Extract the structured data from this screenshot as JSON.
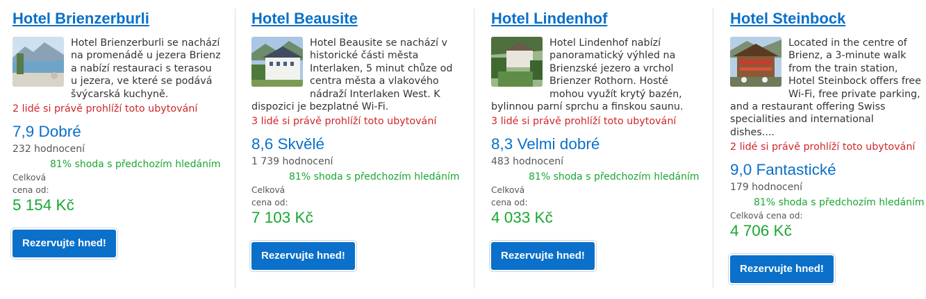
{
  "hotels": [
    {
      "name": "Hotel Brienzerburli",
      "description": "Hotel Brienzerburli se nachází na promenádě u jezera Brienz a nabízí restauraci s terasou u jezera, ve které se podává švýcarská kuchyně.",
      "viewers": "2 lidé si právě prohlíží toto ubytování",
      "score": "7,9 Dobré",
      "reviews": "232 hodnocení",
      "match": "81% shoda s předchozím hledáním",
      "price_label": "Celková cena od:",
      "price": "5 154 Kč",
      "book_label": "Rezervujte hned!",
      "thumb_icon": "lake-promenade-photo"
    },
    {
      "name": "Hotel Beausite",
      "description": "Hotel Beausite se nachází v historické části města Interlaken, 5 minut chůze od centra města a vlakového nádraží Interlaken West. K dispozici je bezplatné Wi-Fi.",
      "viewers": "3 lidé si právě prohlíží toto ubytování",
      "score": "8,6 Skvělé",
      "reviews": "1 739 hodnocení",
      "match": "81% shoda s předchozím hledáním",
      "price_label": "Celková cena od:",
      "price": "7 103 Kč",
      "book_label": "Rezervujte hned!",
      "thumb_icon": "hotel-building-photo"
    },
    {
      "name": "Hotel Lindenhof",
      "description": "Hotel Lindenhof nabízí panoramatický výhled na Brienzské jezero a vrchol Brienzer Rothorn. Hosté mohou využít krytý bazén, bylinnou parní sprchu a finskou saunu.",
      "viewers": "3 lidé si právě prohlíží toto ubytování",
      "score": "8,3 Velmi dobré",
      "reviews": "483 hodnocení",
      "match": "81% shoda s předchozím hledáním",
      "price_label": "Celková cena od:",
      "price": "4 033 Kč",
      "book_label": "Rezervujte hned!",
      "thumb_icon": "garden-hotel-photo"
    },
    {
      "name": "Hotel Steinbock",
      "description": "Located in the centre of Brienz, a 3-minute walk from the train station, Hotel Steinbock offers free Wi-Fi, free private parking, and a restaurant offering Swiss specialities and international dishes....",
      "viewers": "2 lidé si právě prohlíží toto ubytování",
      "score": "9,0 Fantastické",
      "reviews": "179 hodnocení",
      "match": "81% shoda s předchozím hledáním",
      "price_label": "Celková cena od:",
      "price": "4 706 Kč",
      "book_label": "Rezervujte hned!",
      "thumb_icon": "chalet-hotel-photo"
    }
  ],
  "colors": {
    "link_blue": "#0a70c9",
    "price_green": "#19a631",
    "viewers_red": "#d0262a"
  }
}
